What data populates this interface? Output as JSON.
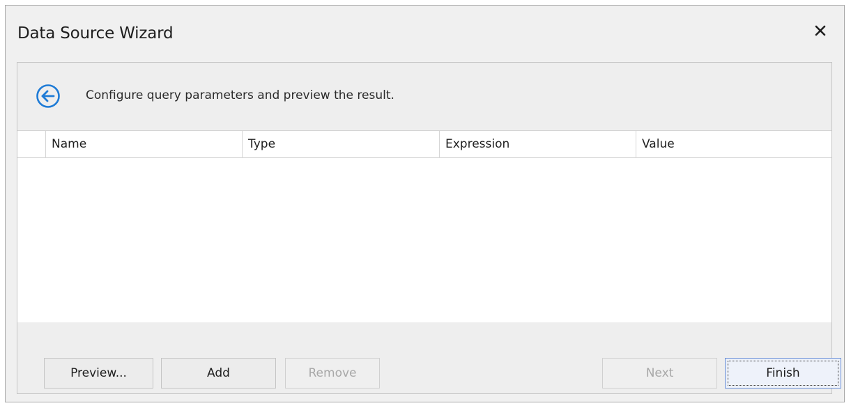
{
  "window": {
    "title": "Data Source Wizard",
    "close_icon": "close-icon"
  },
  "header": {
    "back_icon": "back-arrow-icon",
    "instruction": "Configure query parameters and preview the result."
  },
  "grid": {
    "columns": [
      "Name",
      "Type",
      "Expression",
      "Value"
    ],
    "rows": []
  },
  "buttons": {
    "preview": "Preview...",
    "add": "Add",
    "remove": "Remove",
    "next": "Next",
    "finish": "Finish"
  },
  "colors": {
    "accent": "#1e7bd6",
    "window_bg": "#f0f0f0",
    "disabled_text": "#a8a8a8"
  }
}
